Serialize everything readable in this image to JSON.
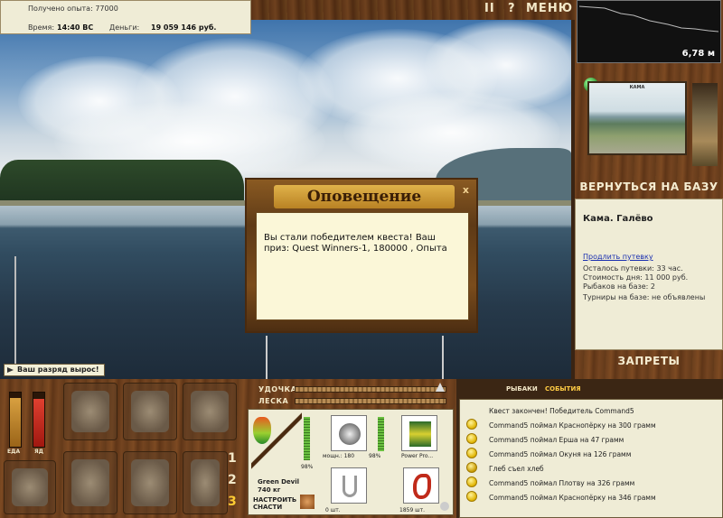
{
  "info": {
    "exp_label": "Получено опыта:",
    "exp_value": "77000",
    "time_label": "Время:",
    "time_value": "14:40 ВС",
    "money_label": "Деньги:",
    "money_value": "19 059 146 руб."
  },
  "top_controls": {
    "pause": "II",
    "help": "?",
    "menu": "МЕНЮ"
  },
  "depth": {
    "value": "6,78 м"
  },
  "map": {
    "caption": "КАМА"
  },
  "right": {
    "back_to_base": "ВЕРНУТЬСЯ НА БАЗУ",
    "base_name": "Кама. Галёво",
    "extend_link": "Продлить путевку",
    "lines": [
      "Осталось путевки: 33 час.",
      "Стоимость дня: 11 000 руб.",
      "Рыбаков на базе: 2",
      "Турниры на базе: не объявлены"
    ],
    "bans": "ЗАПРЕТЫ"
  },
  "dialog": {
    "title": "Оповещение",
    "close": "x",
    "text": "Вы стали победителем квеста! Ваш приз: Quest Winners-1, 180000 , Опыта"
  },
  "rank_notice": "Ваш разряд вырос!",
  "gauges": {
    "food_label": "ЕДА",
    "poison_label": "ЯД",
    "food_level": 0.9,
    "poison_level": 0.88
  },
  "slots": [
    "1",
    "2",
    "3"
  ],
  "bars": {
    "rod_label": "УДОЧКА",
    "line_label": "ЛЕСКА"
  },
  "tackle": {
    "rod_name": "Green Devil",
    "rod_weight": "740 кг",
    "rod_percent": "98%",
    "reel_caption": "мощн.: 180",
    "reel_percent": "98%",
    "line_caption": "Power Pro...",
    "hook_count": "0 шт.",
    "bait_count": "1859 шт.",
    "setup_label": "НАСТРОИТЬ СНАСТИ"
  },
  "chat": {
    "tab_fishers": "РЫБАКИ",
    "tab_events": "СОБЫТИЯ",
    "messages": [
      "Квест закончен! Победитель Command5",
      "Command5 поймал Краснопёрку на 300 грамм",
      "Command5 поймал Ерша на 47 грамм",
      "Command5 поймал Окуня на 126 грамм",
      "Глеб съел хлеб",
      "Command5 поймал Плотву на 326 грамм",
      "Command5 поймал Краснопёрку на 346 грамм"
    ]
  }
}
